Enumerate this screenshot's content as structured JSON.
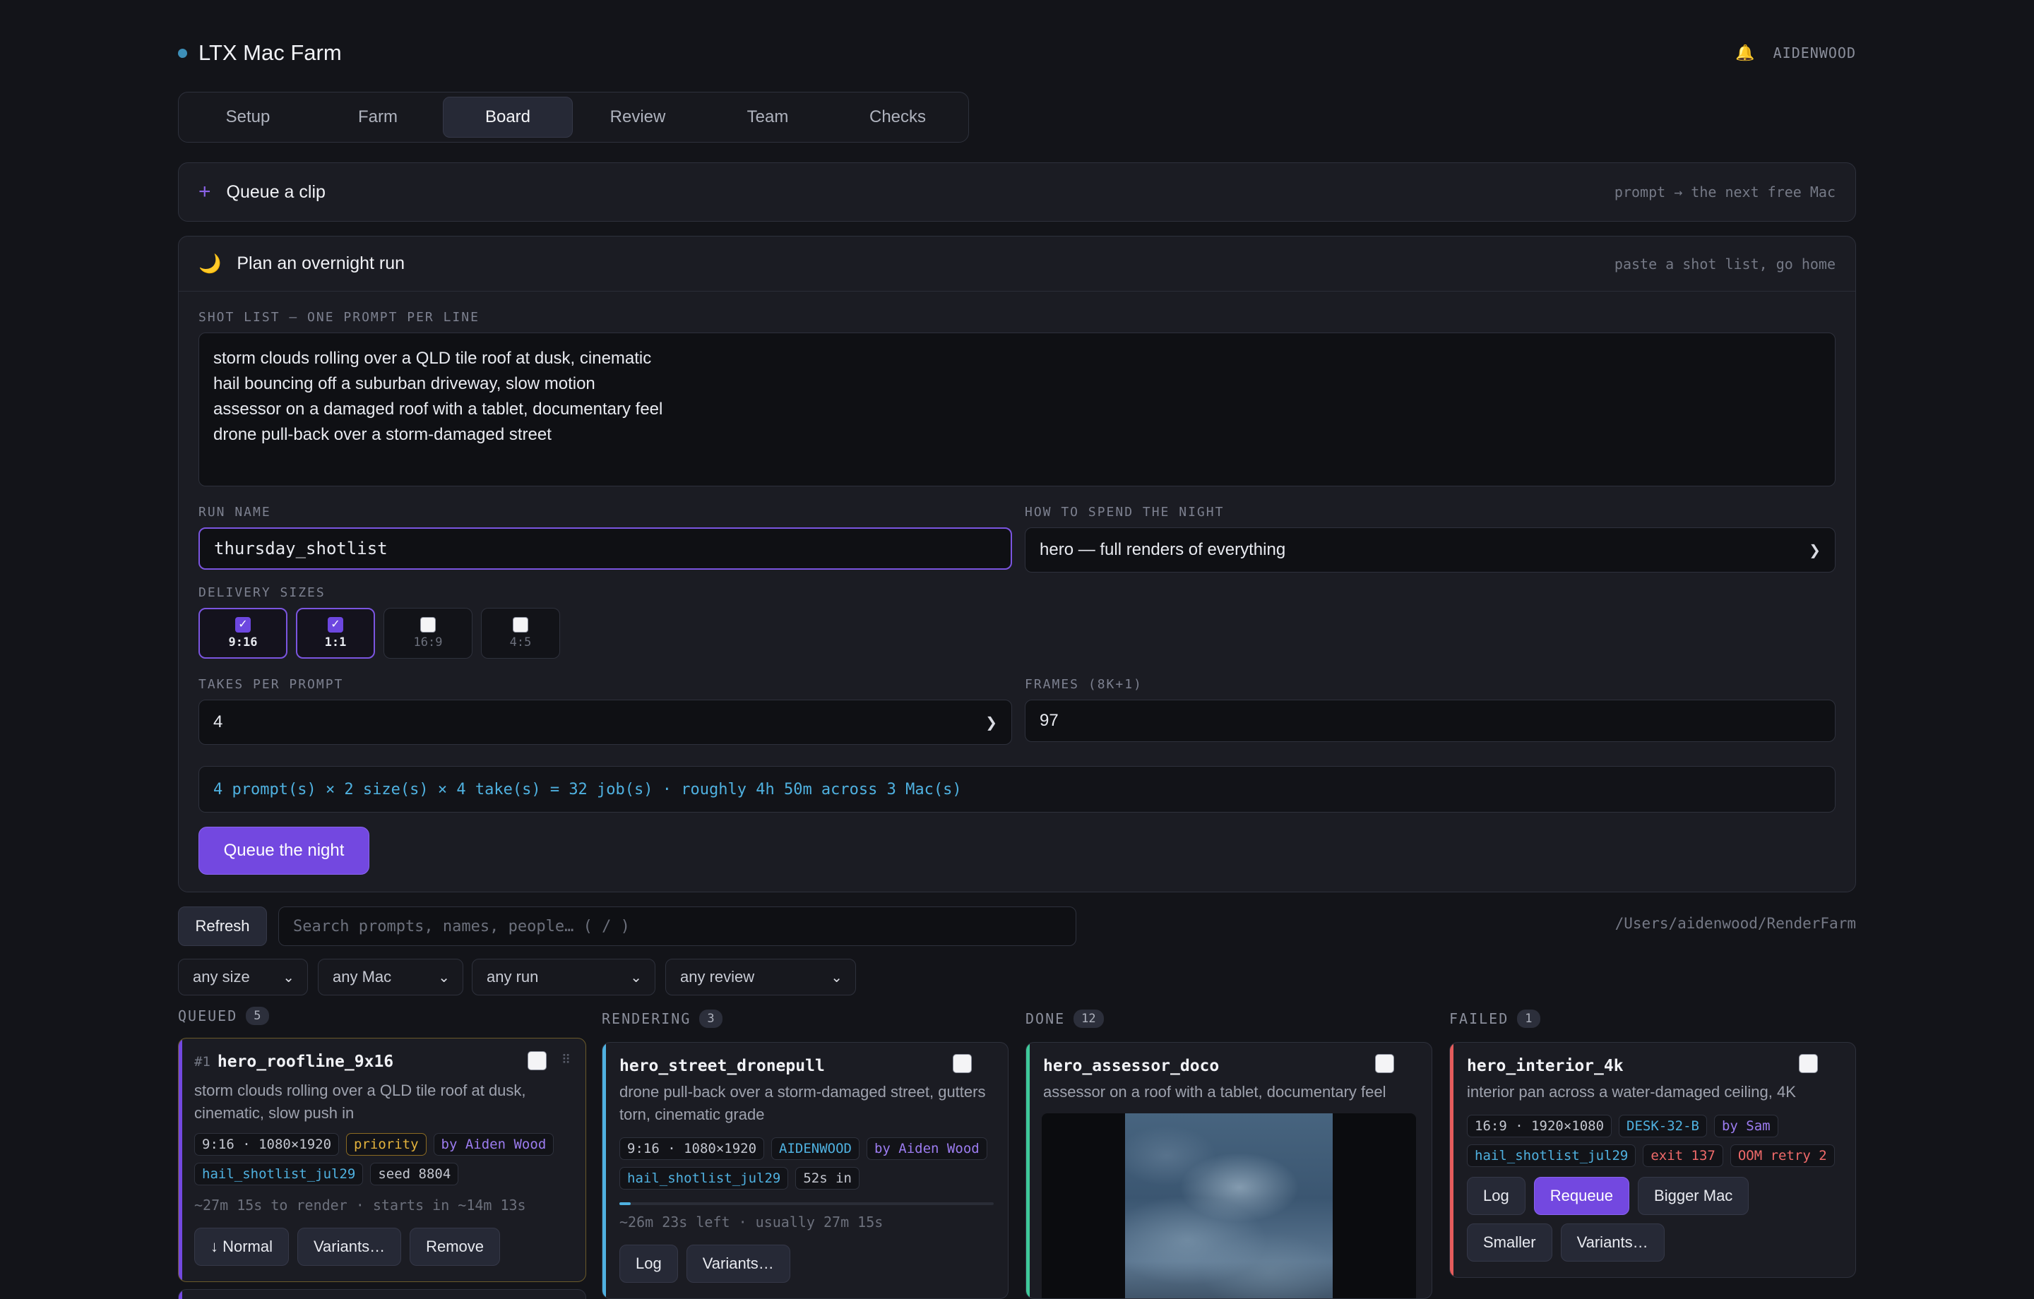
{
  "app": {
    "title": "LTX Mac Farm",
    "bell_icon": "🔔",
    "user": "AIDENWOOD"
  },
  "tabs": [
    {
      "label": "Setup",
      "active": false
    },
    {
      "label": "Farm",
      "active": false
    },
    {
      "label": "Board",
      "active": true
    },
    {
      "label": "Review",
      "active": false
    },
    {
      "label": "Team",
      "active": false
    },
    {
      "label": "Checks",
      "active": false
    }
  ],
  "queue_clip": {
    "icon": "+",
    "title": "Queue a clip",
    "hint": "prompt → the next free Mac"
  },
  "overnight": {
    "icon": "🌙",
    "title": "Plan an overnight run",
    "hint": "paste a shot list, go home",
    "shot_list_label": "SHOT LIST — ONE PROMPT PER LINE",
    "shot_list": [
      "storm clouds rolling over a QLD tile roof at dusk, cinematic",
      "hail bouncing off a suburban driveway, slow motion",
      "assessor on a damaged roof with a tablet, documentary feel",
      "drone pull-back over a storm-damaged street"
    ],
    "run_name_label": "RUN NAME",
    "run_name": "thursday_shotlist",
    "spend_label": "HOW TO SPEND THE NIGHT",
    "spend_value": "hero — full renders of everything",
    "sizes_label": "DELIVERY SIZES",
    "sizes": [
      {
        "label": "9:16",
        "checked": true
      },
      {
        "label": "1:1",
        "checked": true
      },
      {
        "label": "16:9",
        "checked": false
      },
      {
        "label": "4:5",
        "checked": false
      }
    ],
    "takes_label": "TAKES PER PROMPT",
    "takes_value": "4",
    "frames_label": "FRAMES (8K+1)",
    "frames_value": "97",
    "summary": "4 prompt(s) × 2 size(s) × 4 take(s) = 32 job(s) · roughly 4h 50m across 3 Mac(s)",
    "submit_label": "Queue the night"
  },
  "toolbar": {
    "refresh_label": "Refresh",
    "search_placeholder": "Search prompts, names, people…  ( / )",
    "path": "/Users/aidenwood/RenderFarm"
  },
  "filters": [
    "any size",
    "any Mac",
    "any run",
    "any review"
  ],
  "columns": [
    {
      "title": "QUEUED",
      "count": "5",
      "color": "#d6a23a"
    },
    {
      "title": "RENDERING",
      "count": "3",
      "color": "#4fb1e0"
    },
    {
      "title": "DONE",
      "count": "12",
      "color": "#3fc99a"
    },
    {
      "title": "FAILED",
      "count": "1",
      "color": "#e55c5c"
    }
  ],
  "cards": {
    "queued": {
      "index": "#1",
      "name": "hero_roofline_9x16",
      "desc": "storm clouds rolling over a QLD tile roof at dusk, cinematic, slow push in",
      "tags": [
        {
          "text": "9:16 · 1080×1920",
          "style": ""
        },
        {
          "text": "priority",
          "style": "gold"
        },
        {
          "text": "by Aiden Wood",
          "style": "purple"
        },
        {
          "text": "hail_shotlist_jul29",
          "style": "blue"
        },
        {
          "text": "seed 8804",
          "style": ""
        }
      ],
      "meta": "~27m 15s to render · starts in ~14m 13s",
      "buttons": [
        "↓ Normal",
        "Variants…",
        "Remove"
      ]
    },
    "rendering": {
      "name": "hero_street_dronepull",
      "desc": "drone pull-back over a storm-damaged street, gutters torn, cinematic grade",
      "tags": [
        {
          "text": "9:16 · 1080×1920",
          "style": ""
        },
        {
          "text": "AIDENWOOD",
          "style": "blue"
        },
        {
          "text": "by Aiden Wood",
          "style": "purple"
        },
        {
          "text": "hail_shotlist_jul29",
          "style": "blue"
        },
        {
          "text": "52s in",
          "style": ""
        }
      ],
      "progress": 0.03,
      "meta": "~26m 23s left · usually 27m 15s",
      "buttons": [
        "Log",
        "Variants…"
      ]
    },
    "done": {
      "name": "hero_assessor_doco",
      "desc": "assessor on a roof with a tablet, documentary feel"
    },
    "failed": {
      "name": "hero_interior_4k",
      "desc": "interior pan across a water-damaged ceiling, 4K",
      "tags": [
        {
          "text": "16:9 · 1920×1080",
          "style": ""
        },
        {
          "text": "DESK-32-B",
          "style": "blue"
        },
        {
          "text": "by Sam",
          "style": "purple"
        },
        {
          "text": "hail_shotlist_jul29",
          "style": "blue"
        },
        {
          "text": "exit 137",
          "style": "red"
        },
        {
          "text": "OOM retry 2",
          "style": "red"
        }
      ],
      "buttons": [
        "Log",
        "Requeue",
        "Bigger Mac",
        "Smaller",
        "Variants…"
      ]
    }
  }
}
